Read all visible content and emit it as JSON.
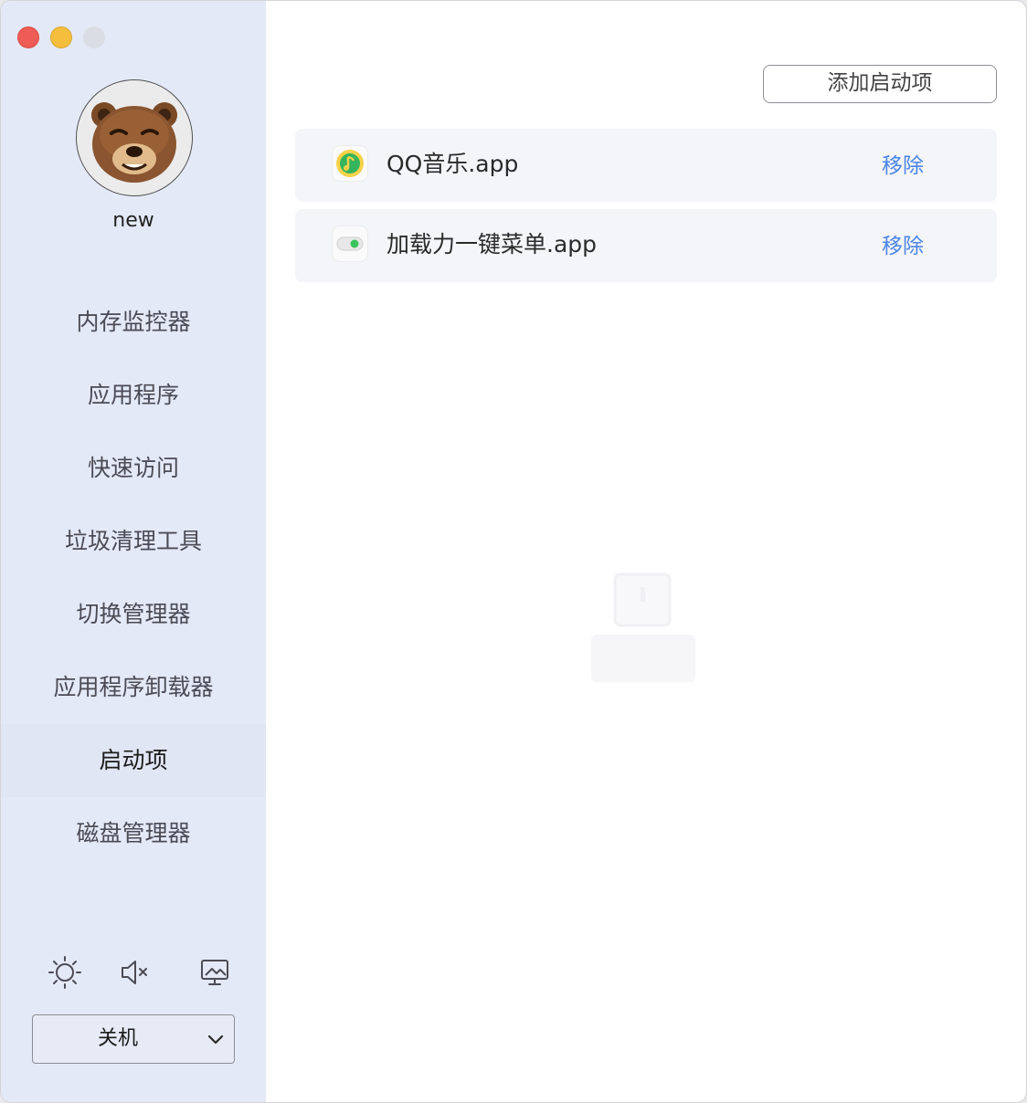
{
  "window": {
    "traffic_lights": [
      "close",
      "minimize",
      "zoom-disabled"
    ]
  },
  "sidebar": {
    "username": "new",
    "avatar": "bear-avatar",
    "items": [
      {
        "label": "内存监控器",
        "active": false
      },
      {
        "label": "应用程序",
        "active": false
      },
      {
        "label": "快速访问",
        "active": false
      },
      {
        "label": "垃圾清理工具",
        "active": false
      },
      {
        "label": "切换管理器",
        "active": false
      },
      {
        "label": "应用程序卸载器",
        "active": false
      },
      {
        "label": "启动项",
        "active": true
      },
      {
        "label": "磁盘管理器",
        "active": false
      }
    ],
    "controls": [
      "brightness-icon",
      "mute-icon",
      "display-icon"
    ],
    "power": {
      "selected": "关机"
    }
  },
  "main": {
    "add_button": "添加启动项",
    "startup_items": [
      {
        "name": "QQ音乐.app",
        "icon": "qq-music-icon",
        "remove": "移除"
      },
      {
        "name": "加载力一键菜单.app",
        "icon": "toggle-app-icon",
        "remove": "移除"
      }
    ]
  },
  "colors": {
    "sidebar_bg": "#e3e9f7",
    "accent_link": "#4b86e6",
    "row_bg": "#f4f5f9"
  }
}
